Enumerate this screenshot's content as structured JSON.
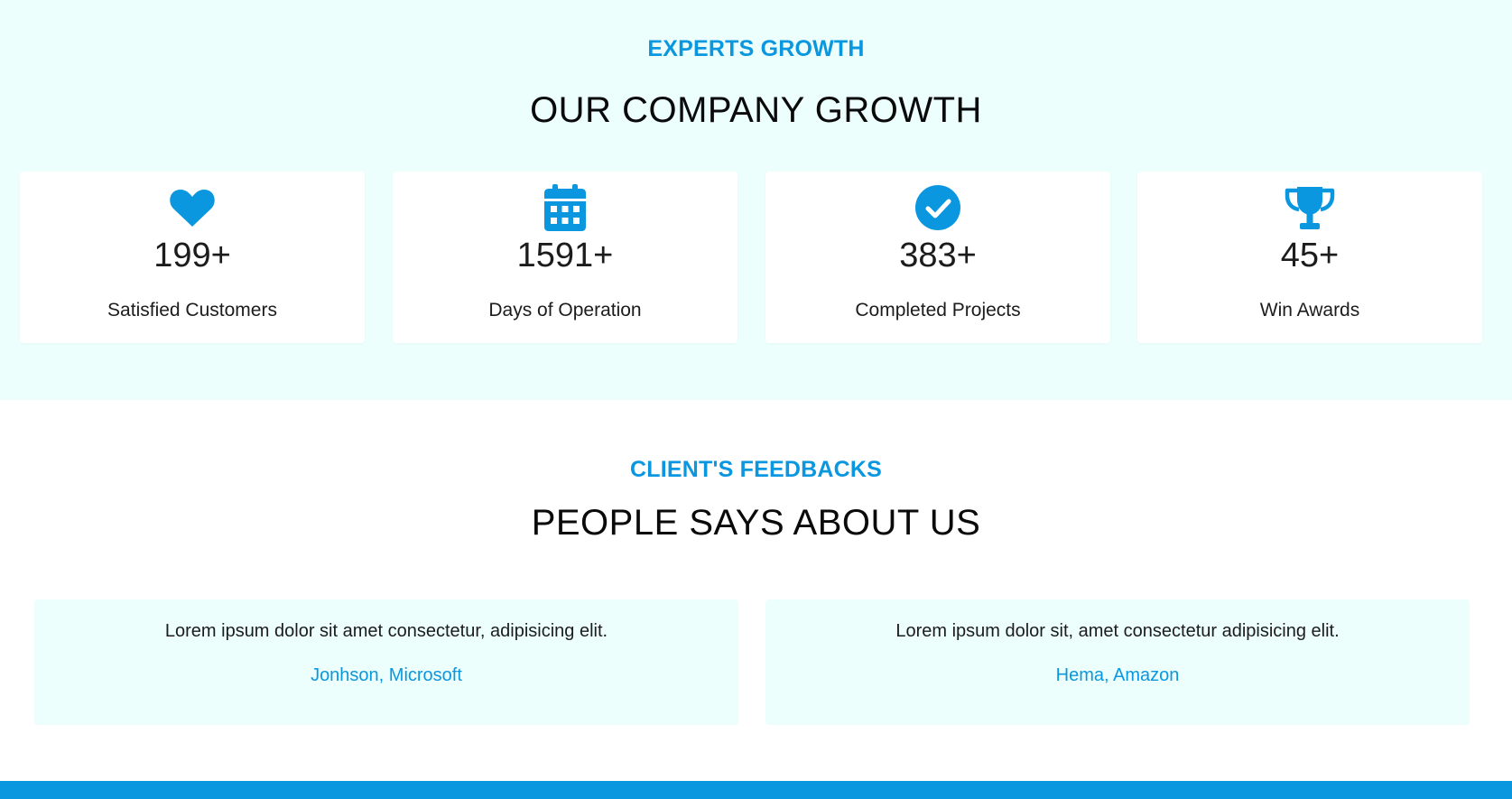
{
  "colors": {
    "accent": "#0a97e0",
    "section_bg": "#ecfffd",
    "card_bg": "#ffffff",
    "text": "#1c1c1c"
  },
  "growth": {
    "eyebrow": "EXPERTS GROWTH",
    "title": "OUR COMPANY GROWTH",
    "stats": [
      {
        "icon": "heart-icon",
        "number": "199+",
        "label": "Satisfied Customers"
      },
      {
        "icon": "calendar-icon",
        "number": "1591+",
        "label": "Days of Operation"
      },
      {
        "icon": "check-circle-icon",
        "number": "383+",
        "label": "Completed Projects"
      },
      {
        "icon": "trophy-icon",
        "number": "45+",
        "label": "Win Awards"
      }
    ]
  },
  "feedback": {
    "eyebrow": "CLIENT'S FEEDBACKS",
    "title": "PEOPLE SAYS ABOUT US",
    "items": [
      {
        "quote": "Lorem ipsum dolor sit amet consectetur, adipisicing elit.",
        "author": "Jonhson, Microsoft"
      },
      {
        "quote": "Lorem ipsum dolor sit, amet consectetur adipisicing elit.",
        "author": "Hema, Amazon"
      }
    ]
  }
}
